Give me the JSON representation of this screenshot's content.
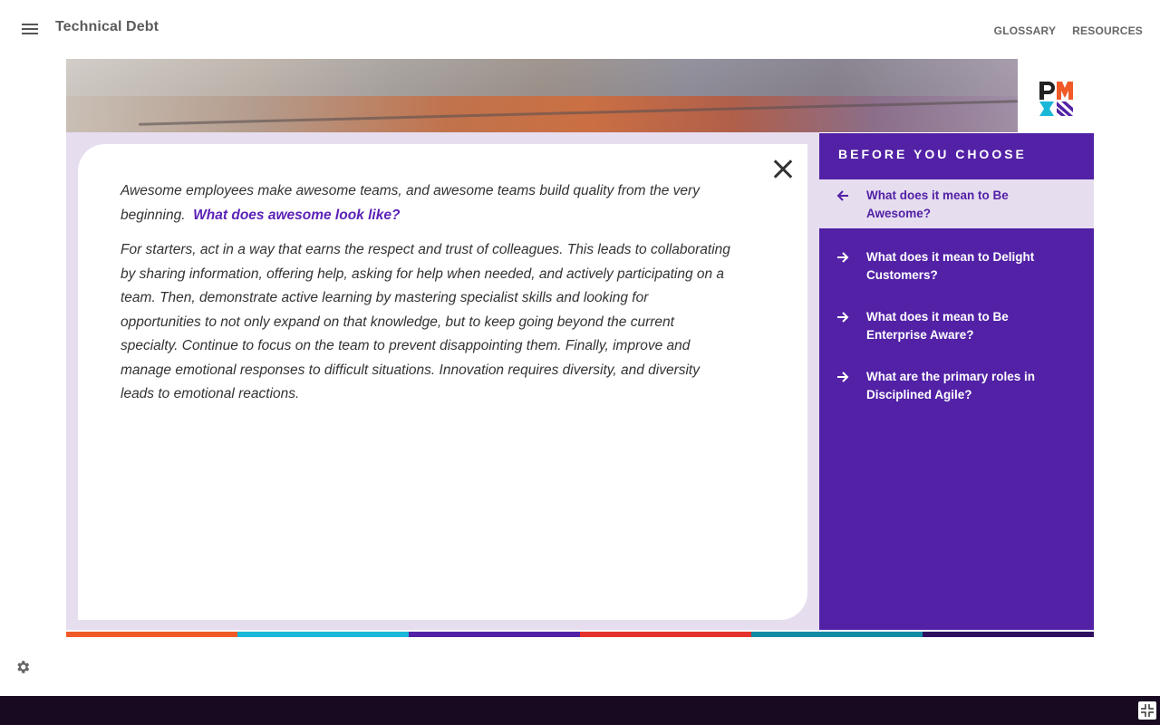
{
  "header": {
    "course_title": "Technical Debt",
    "nav": [
      "GLOSSARY",
      "RESOURCES"
    ]
  },
  "content": {
    "para1_text": "Awesome employees make awesome teams, and awesome teams build quality from the very beginning.",
    "para1_link": "What does awesome look like?",
    "para2_text": "For starters, act in a way that earns the respect and trust of colleagues. This leads to collaborating by sharing information, offering help, asking for help when needed, and actively participating on a team. Then, demonstrate active learning by mastering specialist skills and looking for opportunities to not only expand on that knowledge, but to keep going beyond the current specialty. Continue to focus on the team to prevent disappointing them. Finally, improve and manage emotional responses to difficult situations. Innovation requires diversity, and diversity leads to emotional reactions."
  },
  "sidebar": {
    "title": "BEFORE YOU CHOOSE",
    "items": [
      {
        "label": "What does it mean to Be Awesome?",
        "icon": "arrow-left-icon",
        "active": true
      },
      {
        "label": "What does it mean to Delight Customers?",
        "icon": "arrow-right-icon",
        "active": false
      },
      {
        "label": "What does it mean to Be Enterprise Aware?",
        "icon": "arrow-right-icon",
        "active": false
      },
      {
        "label": "What are the primary roles in Disciplined Agile?",
        "icon": "arrow-right-icon",
        "active": false
      }
    ]
  },
  "colors": {
    "accent": "#5221a6",
    "sidebar_active_bg": "#e6ddef",
    "bottom_bar": "#180a20",
    "stripe": [
      "#f05a28",
      "#1ab7d8",
      "#5221a6",
      "#e6322d",
      "#128ba6",
      "#2f1060"
    ]
  }
}
